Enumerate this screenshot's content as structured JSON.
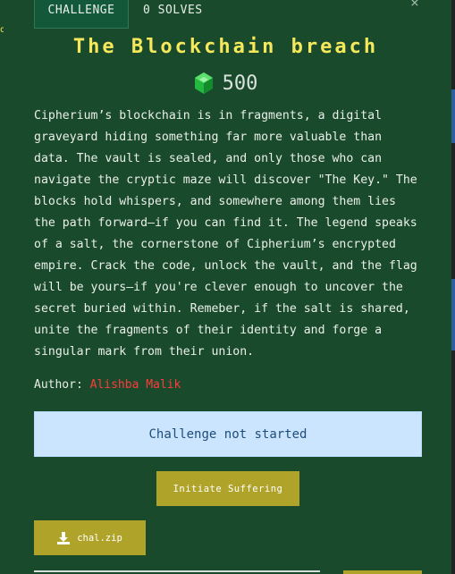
{
  "tabs": {
    "challenge_label": "CHALLENGE",
    "solves_label": "0 SOLVES"
  },
  "challenge": {
    "title": "The Blockchain breach",
    "points": "500",
    "points_icon": "green-gem-icon",
    "description": "Cipherium’s blockchain is in fragments, a digital\ngraveyard hiding something far more valuable than\ndata. The vault is sealed, and only those who can\nnavigate the cryptic maze will discover \"The Key.\" The\nblocks hold whispers, and somewhere among them lies\nthe path forward—if you can find it. The legend speaks\nof a salt, the cornerstone of Cipherium’s encrypted\nempire. Crack the code, unlock the vault, and the flag\nwill be yours—if you're clever enough to uncover the\nsecret buried within. Remeber, if the salt is shared,\nunite the fragments of their identity and forge a\nsingular mark from their union.",
    "author_label": "Author:",
    "author_name": "Alishba Malik",
    "status": "Challenge not started",
    "initiate_label": "Initiate Suffering",
    "file_label": "chal.zip"
  },
  "colors": {
    "modal_bg": "#1a4a2c",
    "title": "#f5e95b",
    "author_name": "#ff3b3b",
    "button": "#b0a32a",
    "status_bg": "#cce5ff"
  }
}
